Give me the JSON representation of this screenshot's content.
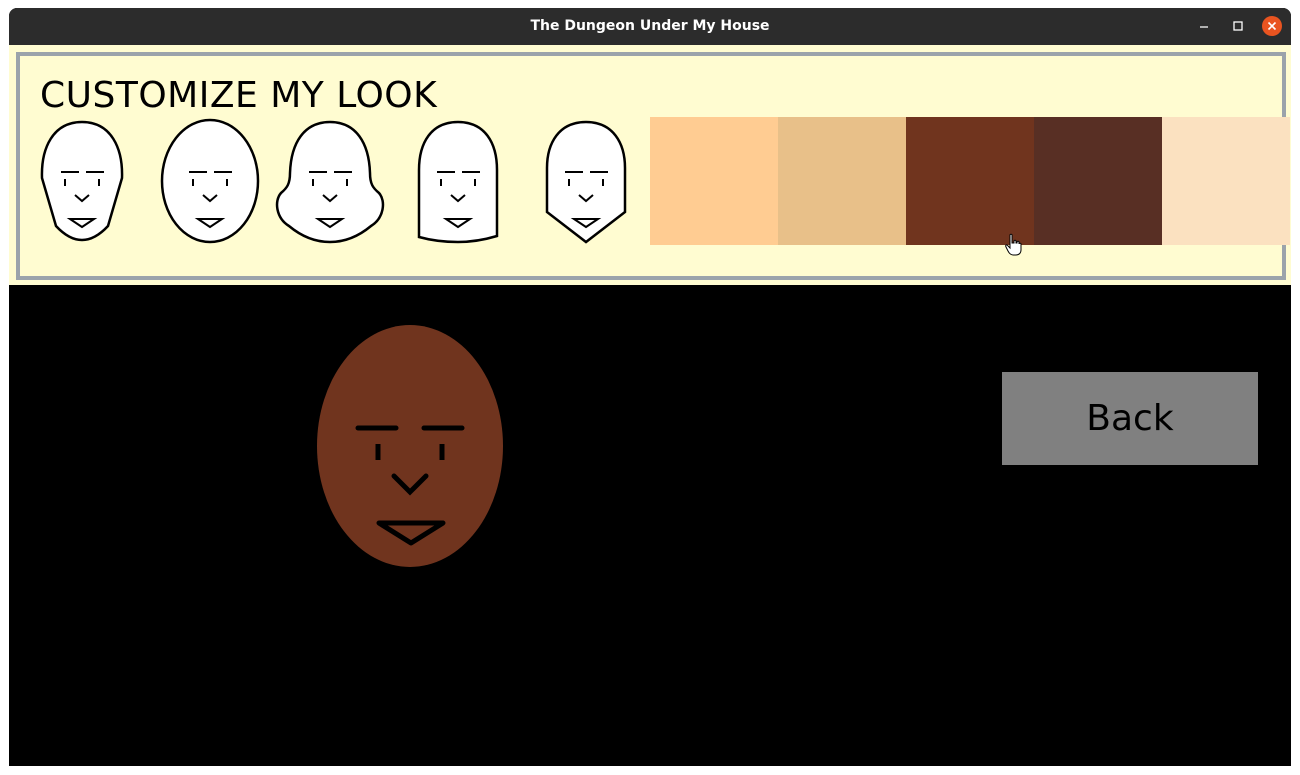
{
  "window": {
    "title": "The Dungeon Under My House"
  },
  "customize": {
    "heading": "CUSTOMIZE MY LOOK",
    "face_shapes": [
      "pointed-chin",
      "oval",
      "round-cheeks",
      "square",
      "hexagon"
    ],
    "skin_tones": [
      {
        "name": "light-peach",
        "color": "#ffcc92"
      },
      {
        "name": "tan",
        "color": "#e8c089"
      },
      {
        "name": "brown",
        "color": "#70341e"
      },
      {
        "name": "dark-brown",
        "color": "#582f24"
      },
      {
        "name": "pale",
        "color": "#fbe1c0"
      }
    ],
    "selected_skin_tone": "brown"
  },
  "preview": {
    "face_shape": "oval",
    "skin_color": "#70341e"
  },
  "back_button": {
    "label": "Back"
  },
  "colors": {
    "panel_background": "#fffcd1",
    "panel_border": "#9ba3ab",
    "game_background": "#000000",
    "button_background": "#808080",
    "close_button": "#e95420"
  },
  "icons": [
    "minimize-icon",
    "maximize-icon",
    "close-icon",
    "hand-pointer-icon"
  ]
}
